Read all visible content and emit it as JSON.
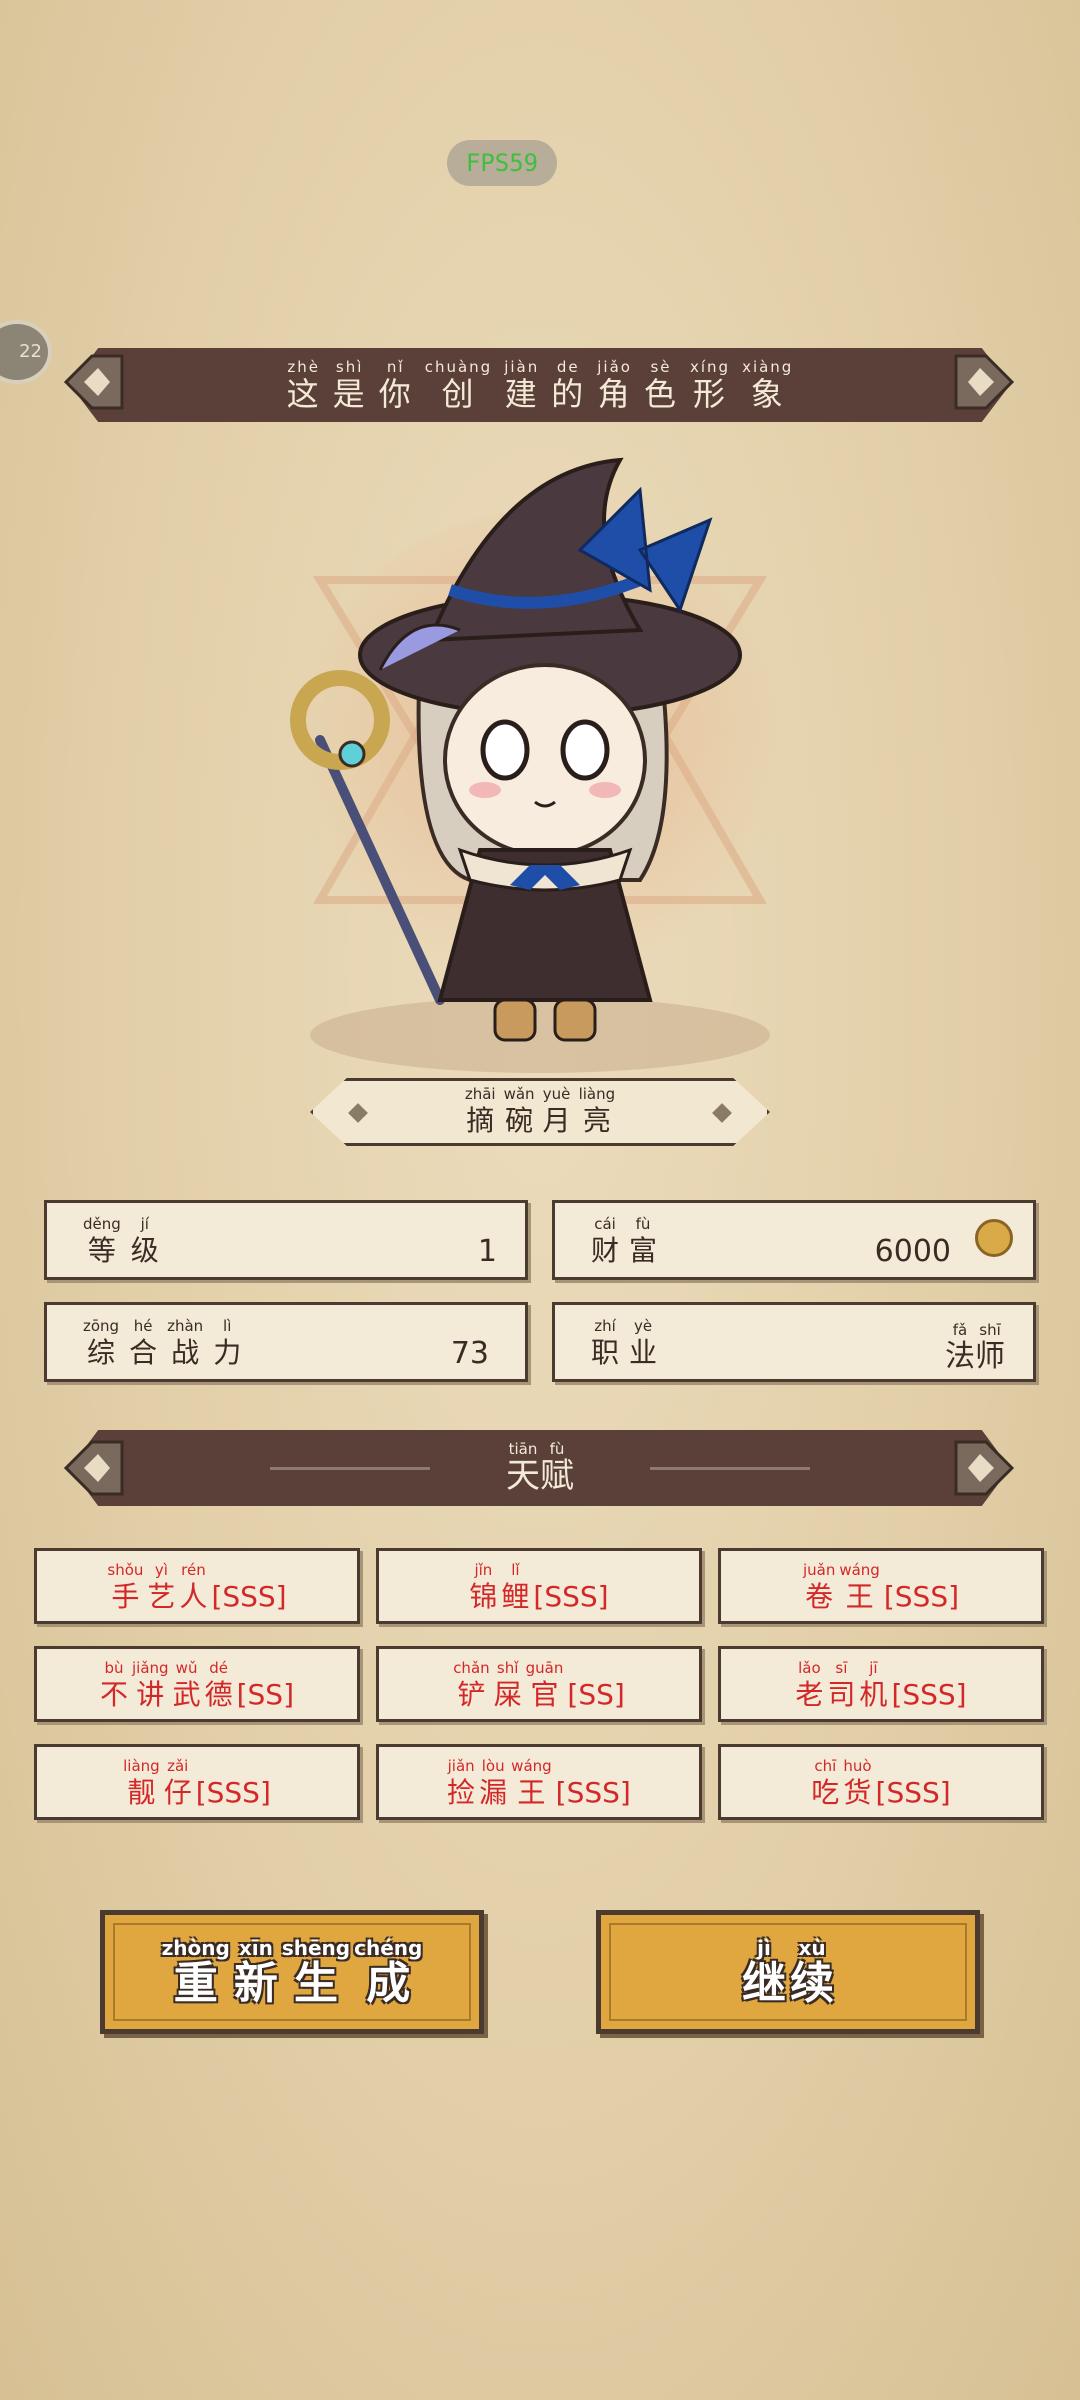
{
  "fps": "FPS59",
  "side_badge": "22",
  "title": [
    {
      "py": "zhè",
      "hz": "这"
    },
    {
      "py": "shì",
      "hz": "是"
    },
    {
      "py": "nǐ",
      "hz": "你"
    },
    {
      "py": "chuàng",
      "hz": "创"
    },
    {
      "py": "jiàn",
      "hz": "建"
    },
    {
      "py": "de",
      "hz": "的"
    },
    {
      "py": "jiǎo",
      "hz": "角"
    },
    {
      "py": "sè",
      "hz": "色"
    },
    {
      "py": "xíng",
      "hz": "形"
    },
    {
      "py": "xiàng",
      "hz": "象"
    }
  ],
  "character_name": [
    {
      "py": "zhāi",
      "hz": "摘"
    },
    {
      "py": "wǎn",
      "hz": "碗"
    },
    {
      "py": "yuè",
      "hz": "月"
    },
    {
      "py": "liàng",
      "hz": "亮"
    }
  ],
  "stats": {
    "level": {
      "label": [
        {
          "py": "děng",
          "hz": "等"
        },
        {
          "py": "jí",
          "hz": "级"
        }
      ],
      "value": "1"
    },
    "wealth": {
      "label": [
        {
          "py": "cái",
          "hz": "财"
        },
        {
          "py": "fù",
          "hz": "富"
        }
      ],
      "value": "6000",
      "icon": "coin-icon"
    },
    "power": {
      "label": [
        {
          "py": "zōng",
          "hz": "综"
        },
        {
          "py": "hé",
          "hz": "合"
        },
        {
          "py": "zhàn",
          "hz": "战"
        },
        {
          "py": "lì",
          "hz": "力"
        }
      ],
      "value": "73"
    },
    "job": {
      "label": [
        {
          "py": "zhí",
          "hz": "职"
        },
        {
          "py": "yè",
          "hz": "业"
        }
      ],
      "value": [
        {
          "py": "fǎ",
          "hz": "法"
        },
        {
          "py": "shī",
          "hz": "师"
        }
      ]
    }
  },
  "talent_title": [
    {
      "py": "tiān",
      "hz": "天"
    },
    {
      "py": "fù",
      "hz": "赋"
    }
  ],
  "talents": [
    {
      "chars": [
        {
          "py": "shǒu",
          "hz": "手"
        },
        {
          "py": "yì",
          "hz": "艺"
        },
        {
          "py": "rén",
          "hz": "人"
        }
      ],
      "grade": "[SSS]"
    },
    {
      "chars": [
        {
          "py": "jǐn",
          "hz": "锦"
        },
        {
          "py": "lǐ",
          "hz": "鲤"
        }
      ],
      "grade": "[SSS]"
    },
    {
      "chars": [
        {
          "py": "juǎn",
          "hz": "卷"
        },
        {
          "py": "wáng",
          "hz": "王"
        }
      ],
      "grade": "[SSS]"
    },
    {
      "chars": [
        {
          "py": "bù",
          "hz": "不"
        },
        {
          "py": "jiǎng",
          "hz": "讲"
        },
        {
          "py": "wǔ",
          "hz": "武"
        },
        {
          "py": "dé",
          "hz": "德"
        }
      ],
      "grade": "[SS]"
    },
    {
      "chars": [
        {
          "py": "chǎn",
          "hz": "铲"
        },
        {
          "py": "shǐ",
          "hz": "屎"
        },
        {
          "py": "guān",
          "hz": "官"
        }
      ],
      "grade": "[SS]"
    },
    {
      "chars": [
        {
          "py": "lǎo",
          "hz": "老"
        },
        {
          "py": "sī",
          "hz": "司"
        },
        {
          "py": "jī",
          "hz": "机"
        }
      ],
      "grade": "[SSS]"
    },
    {
      "chars": [
        {
          "py": "liàng",
          "hz": "靓"
        },
        {
          "py": "zǎi",
          "hz": "仔"
        }
      ],
      "grade": "[SSS]"
    },
    {
      "chars": [
        {
          "py": "jiǎn",
          "hz": "捡"
        },
        {
          "py": "lòu",
          "hz": "漏"
        },
        {
          "py": "wáng",
          "hz": "王"
        }
      ],
      "grade": "[SSS]"
    },
    {
      "chars": [
        {
          "py": "chī",
          "hz": "吃"
        },
        {
          "py": "huò",
          "hz": "货"
        }
      ],
      "grade": "[SSS]"
    }
  ],
  "buttons": {
    "regenerate": [
      {
        "py": "zhòng",
        "hz": "重"
      },
      {
        "py": "xīn",
        "hz": "新"
      },
      {
        "py": "shēng",
        "hz": "生"
      },
      {
        "py": "chéng",
        "hz": "成"
      }
    ],
    "continue": [
      {
        "py": "jì",
        "hz": "继"
      },
      {
        "py": "xù",
        "hz": "续"
      }
    ]
  },
  "colors": {
    "banner": "#5a4038",
    "talent_text": "#d42828",
    "button": "#e0a640",
    "background": "#e6d4b0"
  }
}
